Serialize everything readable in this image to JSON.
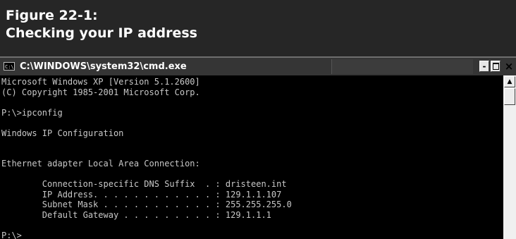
{
  "figure": {
    "line1": "Figure 22-1:",
    "line2": "Checking your IP address"
  },
  "window": {
    "title": "C:\\WINDOWS\\system32\\cmd.exe",
    "icon": "cmd-icon",
    "controls": {
      "minimize": "-",
      "maximize": "□",
      "close": "×"
    }
  },
  "console": {
    "lines": [
      "Microsoft Windows XP [Version 5.1.2600]",
      "(C) Copyright 1985-2001 Microsoft Corp.",
      "",
      "P:\\>ipconfig",
      "",
      "Windows IP Configuration",
      "",
      "",
      "Ethernet adapter Local Area Connection:",
      "",
      "        Connection-specific DNS Suffix  . : dristeen.int",
      "        IP Address. . . . . . . . . . . . : 129.1.1.107",
      "        Subnet Mask . . . . . . . . . . . : 255.255.255.0",
      "        Default Gateway . . . . . . . . . : 129.1.1.1",
      "",
      "P:\\>"
    ]
  },
  "colors": {
    "figure_header_bg": "#262626",
    "titlebar_bg": "#353535",
    "console_bg": "#000000",
    "console_text": "#c8c8c8"
  }
}
